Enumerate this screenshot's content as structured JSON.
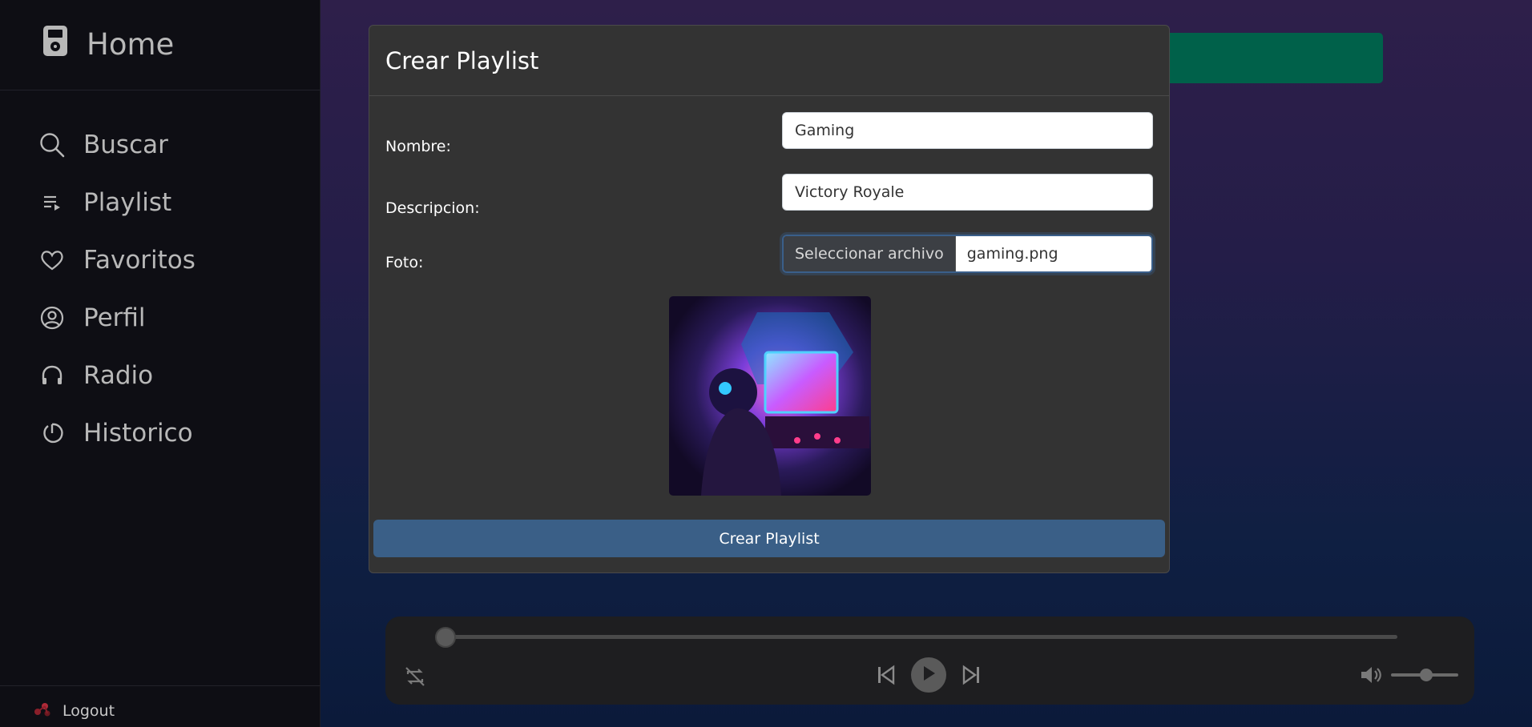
{
  "sidebar": {
    "home_label": "Home",
    "items": [
      {
        "label": "Buscar",
        "icon": "search-icon"
      },
      {
        "label": "Playlist",
        "icon": "playlist-icon"
      },
      {
        "label": "Favoritos",
        "icon": "heart-icon"
      },
      {
        "label": "Perfil",
        "icon": "user-circle-icon"
      },
      {
        "label": "Radio",
        "icon": "headphones-icon"
      },
      {
        "label": "Historico",
        "icon": "history-icon"
      }
    ],
    "logout_label": "Logout"
  },
  "modal": {
    "title": "Crear Playlist",
    "nombre_label": "Nombre:",
    "nombre_value": "Gaming",
    "descripcion_label": "Descripcion:",
    "descripcion_value": "Victory Royale",
    "foto_label": "Foto:",
    "file_button_label": "Seleccionar archivo",
    "file_name": "gaming.png",
    "submit_label": "Crear Playlist"
  },
  "player": {
    "progress": 0,
    "volume": 0.55
  },
  "colors": {
    "accent": "#3a5f87",
    "teal": "#00614a"
  }
}
